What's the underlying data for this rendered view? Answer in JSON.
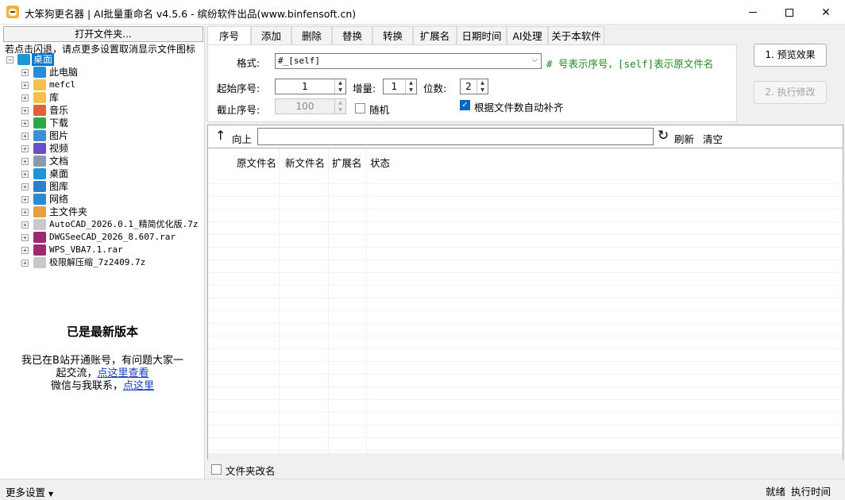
{
  "window": {
    "title": "大笨狗更名器 | AI批量重命名 v4.5.6 - 缤纷软件出品(www.binfensoft.cn)",
    "minimize": "—",
    "close": "✕"
  },
  "left": {
    "open_folder": "打开文件夹...",
    "hint": "若点击闪退，请点更多设置取消显示文件图标",
    "tree_root": "桌面",
    "tree": [
      {
        "label": "此电脑",
        "icon": "computer-icon",
        "color": "#2a8ad8"
      },
      {
        "label": "mefcl",
        "icon": "folder-icon",
        "color": "#f3c14b"
      },
      {
        "label": "库",
        "icon": "library-folder-icon",
        "color": "#f3c14b"
      },
      {
        "label": "音乐",
        "icon": "music-icon",
        "color": "#e0603e"
      },
      {
        "label": "下载",
        "icon": "download-icon",
        "color": "#2aa84a"
      },
      {
        "label": "图片",
        "icon": "pictures-icon",
        "color": "#3a8fd6"
      },
      {
        "label": "视频",
        "icon": "video-icon",
        "color": "#6a4fc8"
      },
      {
        "label": "文档",
        "icon": "documents-icon",
        "color": "#8a9aaa"
      },
      {
        "label": "桌面",
        "icon": "desktop-icon",
        "color": "#1e96d6"
      },
      {
        "label": "图库",
        "icon": "gallery-icon",
        "color": "#2a7fd0"
      },
      {
        "label": "网络",
        "icon": "network-icon",
        "color": "#2a8ad8"
      },
      {
        "label": "主文件夹",
        "icon": "home-icon",
        "color": "#e6a23c"
      },
      {
        "label": "AutoCAD_2026.0.1_精简优化版.7z",
        "icon": "7z-archive-icon",
        "color": "#c9c9c9"
      },
      {
        "label": "DWGSeeCAD_2026_8.607.rar",
        "icon": "rar-archive-icon",
        "color": "#9b2a6e"
      },
      {
        "label": "WPS_VBA7.1.rar",
        "icon": "rar-archive-icon",
        "color": "#9b2a6e"
      },
      {
        "label": "极限解压缩_7z2409.7z",
        "icon": "7z-archive-icon",
        "color": "#c9c9c9"
      }
    ],
    "version_status": "已是最新版本",
    "info_line1": "我已在B站开通账号，有问题大家一",
    "info_line2_text": "起交流，",
    "info_line2_link": "点这里查看",
    "info_line3_text": "微信与我联系，",
    "info_line3_link": "点这里"
  },
  "tabs": [
    "序号",
    "添加",
    "删除",
    "替换",
    "转换",
    "扩展名",
    "日期时间",
    "AI处理",
    "关于本软件"
  ],
  "sequence": {
    "format_label": "格式:",
    "format_value": "#_[self]",
    "format_hint": "# 号表示序号，[self]表示原文件名",
    "start_label": "起始序号:",
    "start_value": "1",
    "step_label": "增量:",
    "step_value": "1",
    "digits_label": "位数:",
    "digits_value": "2",
    "end_label": "截止序号:",
    "end_value": "100",
    "random_label": "随机",
    "auto_pad_label": "根据文件数自动补齐"
  },
  "actions": {
    "preview": "1. 预览效果",
    "execute": "2. 执行修改"
  },
  "pathbar": {
    "up_label": "向上",
    "path_value": "",
    "refresh_label": "刷新",
    "clear_label": "清空"
  },
  "list": {
    "columns": [
      "原文件名",
      "新文件名",
      "扩展名",
      "状态"
    ]
  },
  "bottom": {
    "folder_rename_label": "文件夹改名",
    "more_settings": "更多设置",
    "status_ready": "就绪",
    "status_exec_time": "执行时间"
  },
  "colors": {
    "accent": "#0078d7",
    "hint_green": "#1d8a1d",
    "link_blue": "#1a3bbd"
  }
}
